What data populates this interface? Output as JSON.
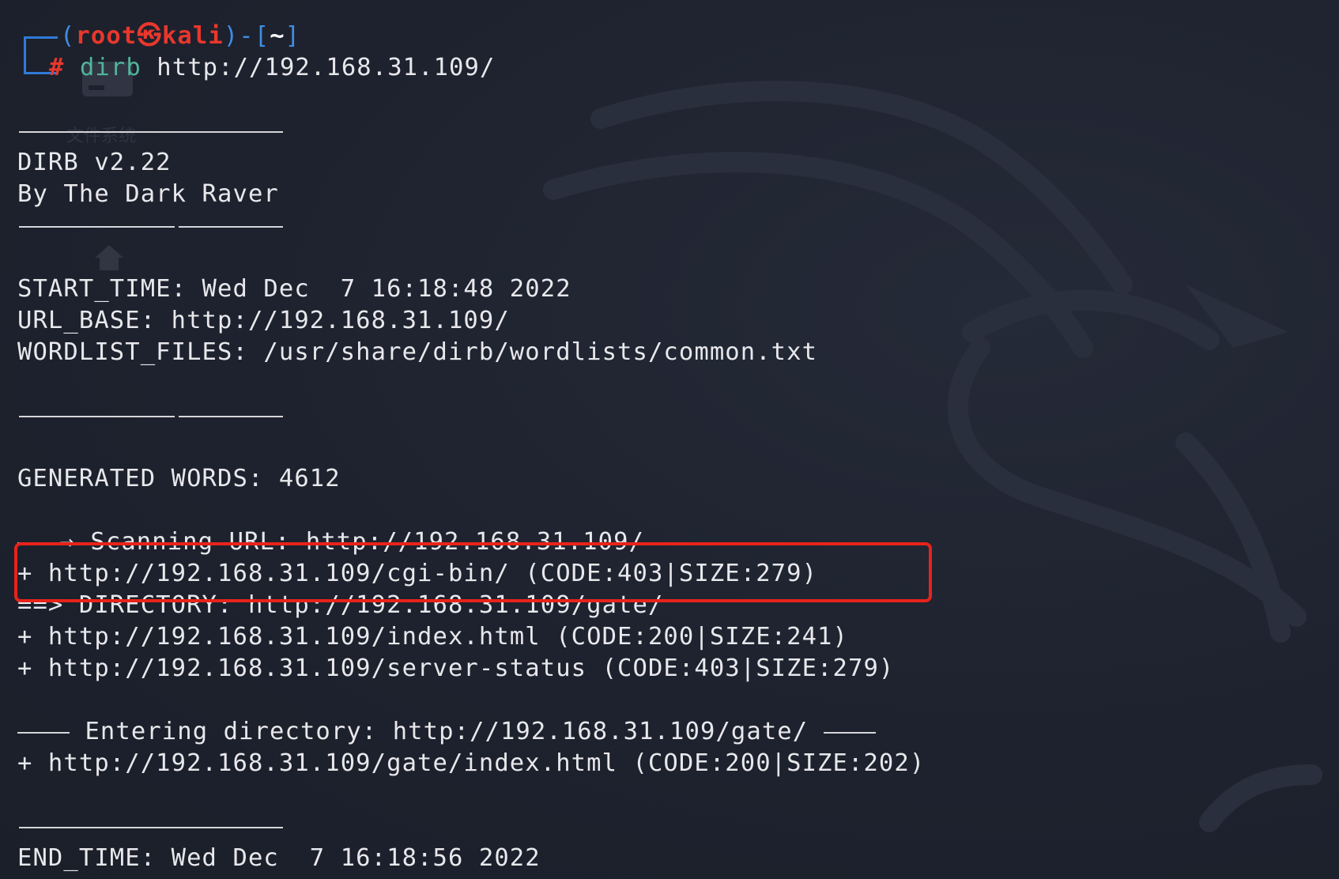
{
  "prompt": {
    "user": "root",
    "at_symbol": "㉿",
    "host": "kali",
    "dir": "~",
    "hash": "#",
    "command": "dirb",
    "argument": "http://192.168.31.109/"
  },
  "banner": {
    "version": "DIRB v2.22",
    "author": "By The Dark Raver"
  },
  "config": {
    "start_time": "START_TIME: Wed Dec  7 16:18:48 2022",
    "url_base": "URL_BASE: http://192.168.31.109/",
    "wordlist": "WORDLIST_FILES: /usr/share/dirb/wordlists/common.txt"
  },
  "generated_words": "GENERATED WORDS: 4612",
  "scanning": {
    "label": "Scanning URL: http://192.168.31.109/",
    "results": [
      "+ http://192.168.31.109/cgi-bin/ (CODE:403|SIZE:279)",
      "DIRECTORY: http://192.168.31.109/gate/",
      "+ http://192.168.31.109/index.html (CODE:200|SIZE:241)",
      "+ http://192.168.31.109/server-status (CODE:403|SIZE:279)"
    ],
    "directory_arrow": "==>"
  },
  "entering": {
    "label": "Entering directory: http://192.168.31.109/gate/",
    "results": [
      "+ http://192.168.31.109/gate/index.html (CODE:200|SIZE:202)"
    ]
  },
  "end_time": "END_TIME: Wed Dec  7 16:18:56 2022",
  "desktop_ghost": {
    "folder_label": "文件系统"
  },
  "colors": {
    "background": "#1e222e",
    "text": "#e8e8ec",
    "prompt_blue": "#3f8ce3",
    "prompt_red": "#e8372c",
    "command_green": "#4fb59a",
    "highlight_red": "#e8231a"
  }
}
